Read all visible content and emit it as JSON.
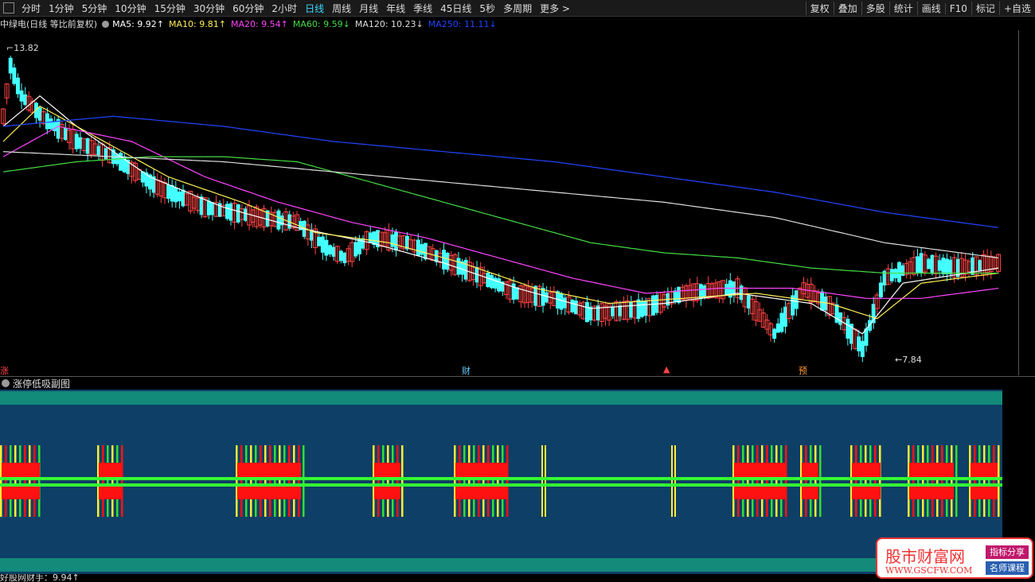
{
  "toolbar": {
    "periods": [
      "分时",
      "1分钟",
      "5分钟",
      "10分钟",
      "15分钟",
      "30分钟",
      "60分钟",
      "2小时",
      "日线",
      "周线",
      "月线",
      "年线",
      "季线",
      "45日线",
      "5秒",
      "多周期",
      "更多 >"
    ],
    "active_period": "日线",
    "right_buttons": [
      "复权",
      "叠加",
      "多股",
      "统计",
      "画线",
      "F10",
      "标记",
      "+自选"
    ]
  },
  "legend": {
    "stock": "中绿电(日线 等比前复权)",
    "ma": [
      {
        "label": "MA5: 9.92↑",
        "color": "#ffffff"
      },
      {
        "label": "MA10: 9.81↑",
        "color": "#ffee55"
      },
      {
        "label": "MA20: 9.54↑",
        "color": "#ff44ff"
      },
      {
        "label": "MA60: 9.59↓",
        "color": "#44dd44"
      },
      {
        "label": "MA120: 10.23↓",
        "color": "#dddddd"
      },
      {
        "label": "MA250: 11.11↓",
        "color": "#2244ff"
      }
    ]
  },
  "chart_data": {
    "type": "candlestick",
    "high_label": "13.82",
    "low_label": "7.84",
    "ylim": [
      7.6,
      14.2
    ],
    "up_color": "#ff4444",
    "down_color": "#44ffff",
    "anchors": [
      [
        0,
        12.5
      ],
      [
        2,
        13.5
      ],
      [
        5,
        12.9
      ],
      [
        12,
        12.4
      ],
      [
        20,
        12.0
      ],
      [
        30,
        11.7
      ],
      [
        42,
        11.1
      ],
      [
        55,
        10.7
      ],
      [
        70,
        10.5
      ],
      [
        80,
        10.4
      ],
      [
        88,
        9.9
      ],
      [
        93,
        9.7
      ],
      [
        100,
        10.1
      ],
      [
        110,
        10.0
      ],
      [
        125,
        9.5
      ],
      [
        140,
        9.0
      ],
      [
        150,
        8.9
      ],
      [
        160,
        8.6
      ],
      [
        175,
        8.7
      ],
      [
        185,
        9.0
      ],
      [
        200,
        9.1
      ],
      [
        210,
        8.2
      ],
      [
        218,
        9.1
      ],
      [
        226,
        8.7
      ],
      [
        234,
        7.9
      ],
      [
        240,
        9.3
      ],
      [
        250,
        9.6
      ],
      [
        260,
        9.5
      ],
      [
        271,
        9.6
      ]
    ],
    "ma_lines": [
      {
        "name": "MA5",
        "color": "#ffffff",
        "pts": [
          [
            0,
            12.3
          ],
          [
            10,
            12.9
          ],
          [
            20,
            12.3
          ],
          [
            40,
            11.3
          ],
          [
            60,
            10.7
          ],
          [
            80,
            10.3
          ],
          [
            100,
            10.0
          ],
          [
            120,
            9.6
          ],
          [
            140,
            9.1
          ],
          [
            160,
            8.7
          ],
          [
            180,
            8.8
          ],
          [
            200,
            9.0
          ],
          [
            220,
            8.8
          ],
          [
            234,
            8.2
          ],
          [
            245,
            9.2
          ],
          [
            271,
            9.5
          ]
        ]
      },
      {
        "name": "MA10",
        "color": "#ffee55",
        "pts": [
          [
            0,
            12.0
          ],
          [
            10,
            12.7
          ],
          [
            25,
            12.1
          ],
          [
            45,
            11.3
          ],
          [
            65,
            10.8
          ],
          [
            85,
            10.2
          ],
          [
            105,
            10.0
          ],
          [
            125,
            9.6
          ],
          [
            145,
            9.1
          ],
          [
            165,
            8.8
          ],
          [
            185,
            8.9
          ],
          [
            205,
            9.0
          ],
          [
            225,
            8.8
          ],
          [
            238,
            8.5
          ],
          [
            250,
            9.2
          ],
          [
            271,
            9.4
          ]
        ]
      },
      {
        "name": "MA20",
        "color": "#ff44ff",
        "pts": [
          [
            0,
            11.7
          ],
          [
            15,
            12.3
          ],
          [
            35,
            12.0
          ],
          [
            55,
            11.3
          ],
          [
            75,
            10.8
          ],
          [
            95,
            10.4
          ],
          [
            115,
            10.1
          ],
          [
            135,
            9.7
          ],
          [
            155,
            9.3
          ],
          [
            175,
            9.0
          ],
          [
            195,
            9.1
          ],
          [
            215,
            9.1
          ],
          [
            235,
            8.9
          ],
          [
            250,
            8.9
          ],
          [
            271,
            9.1
          ]
        ]
      },
      {
        "name": "MA60",
        "color": "#44dd44",
        "pts": [
          [
            0,
            11.4
          ],
          [
            20,
            11.6
          ],
          [
            40,
            11.7
          ],
          [
            60,
            11.7
          ],
          [
            80,
            11.6
          ],
          [
            100,
            11.2
          ],
          [
            120,
            10.8
          ],
          [
            140,
            10.4
          ],
          [
            160,
            10.0
          ],
          [
            180,
            9.8
          ],
          [
            200,
            9.7
          ],
          [
            220,
            9.5
          ],
          [
            240,
            9.4
          ],
          [
            271,
            9.4
          ]
        ]
      },
      {
        "name": "MA120",
        "color": "#dddddd",
        "pts": [
          [
            0,
            11.8
          ],
          [
            30,
            11.7
          ],
          [
            60,
            11.6
          ],
          [
            90,
            11.4
          ],
          [
            120,
            11.2
          ],
          [
            150,
            11.0
          ],
          [
            180,
            10.8
          ],
          [
            210,
            10.5
          ],
          [
            240,
            10.0
          ],
          [
            271,
            9.7
          ]
        ]
      },
      {
        "name": "MA250",
        "color": "#2244ff",
        "pts": [
          [
            0,
            12.3
          ],
          [
            30,
            12.5
          ],
          [
            60,
            12.3
          ],
          [
            90,
            12.0
          ],
          [
            120,
            11.8
          ],
          [
            150,
            11.6
          ],
          [
            180,
            11.3
          ],
          [
            210,
            11.0
          ],
          [
            240,
            10.6
          ],
          [
            271,
            10.3
          ]
        ]
      }
    ]
  },
  "bottom_marks": [
    {
      "text": "涨",
      "x": 0,
      "color": "#ff4444"
    },
    {
      "text": "财",
      "x": 580,
      "color": "#66ccff"
    },
    {
      "text": "▲",
      "x": 833,
      "color": "#ff4444"
    },
    {
      "text": "预",
      "x": 1003,
      "color": "#ff9933"
    }
  ],
  "sub_panel": {
    "title": "涨停低吸副图",
    "clusters": [
      [
        0,
        52
      ],
      [
        122,
        155
      ],
      [
        296,
        380
      ],
      [
        468,
        505
      ],
      [
        570,
        638
      ],
      [
        680,
        684
      ],
      [
        843,
        847
      ],
      [
        920,
        990
      ],
      [
        1005,
        1030
      ],
      [
        1068,
        1108
      ],
      [
        1140,
        1200
      ],
      [
        1217,
        1255
      ]
    ]
  },
  "bottom_bar": {
    "text": "好股网财手：9.94↑"
  },
  "watermark": {
    "title": "股市财富网",
    "url": "WWW.GSCFW.COM",
    "badge1": "指标分享",
    "badge2": "名师课程"
  }
}
